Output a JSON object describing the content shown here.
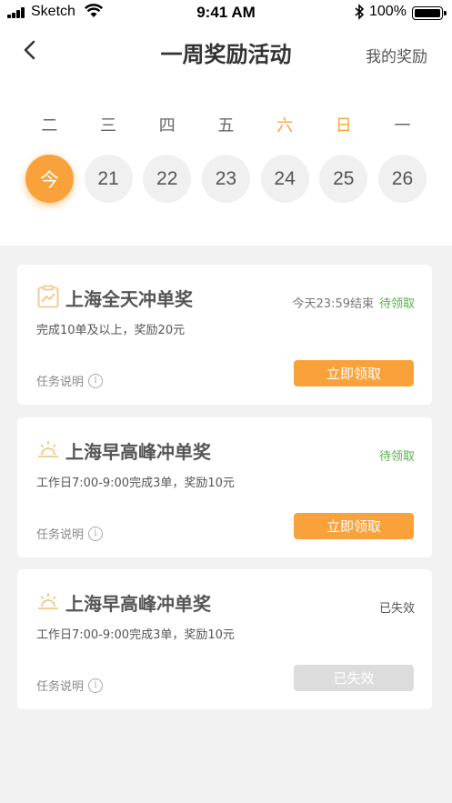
{
  "status_bar": {
    "carrier": "Sketch",
    "time": "9:41 AM",
    "battery": "100%"
  },
  "nav": {
    "title": "一周奖励活动",
    "right_link": "我的奖励"
  },
  "week": {
    "days": [
      {
        "label": "二",
        "date": "今",
        "weekend": false,
        "today": true
      },
      {
        "label": "三",
        "date": "21",
        "weekend": false,
        "today": false
      },
      {
        "label": "四",
        "date": "22",
        "weekend": false,
        "today": false
      },
      {
        "label": "五",
        "date": "23",
        "weekend": false,
        "today": false
      },
      {
        "label": "六",
        "date": "24",
        "weekend": true,
        "today": false
      },
      {
        "label": "日",
        "date": "25",
        "weekend": true,
        "today": false
      },
      {
        "label": "一",
        "date": "26",
        "weekend": false,
        "today": false
      }
    ]
  },
  "colors": {
    "accent": "#f9a23b",
    "status_green": "#5ab04c",
    "disabled": "#dcdcdc"
  },
  "tasks": [
    {
      "icon": "chart-clipboard-icon",
      "title": "上海全天冲单奖",
      "deadline": "今天23:59结束",
      "status": "待领取",
      "status_type": "green",
      "desc": "完成10单及以上，奖励20元",
      "info_label": "任务说明",
      "button": "立即领取",
      "button_state": "active"
    },
    {
      "icon": "sunrise-icon",
      "title": "上海早高峰冲单奖",
      "deadline": "",
      "status": "待领取",
      "status_type": "green",
      "desc": "工作日7:00-9:00完成3单，奖励10元",
      "info_label": "任务说明",
      "button": "立即领取",
      "button_state": "active"
    },
    {
      "icon": "sunrise-icon",
      "title": "上海早高峰冲单奖",
      "deadline": "",
      "status": "已失效",
      "status_type": "grey",
      "desc": "工作日7:00-9:00完成3单，奖励10元",
      "info_label": "任务说明",
      "button": "已失效",
      "button_state": "disabled"
    }
  ]
}
